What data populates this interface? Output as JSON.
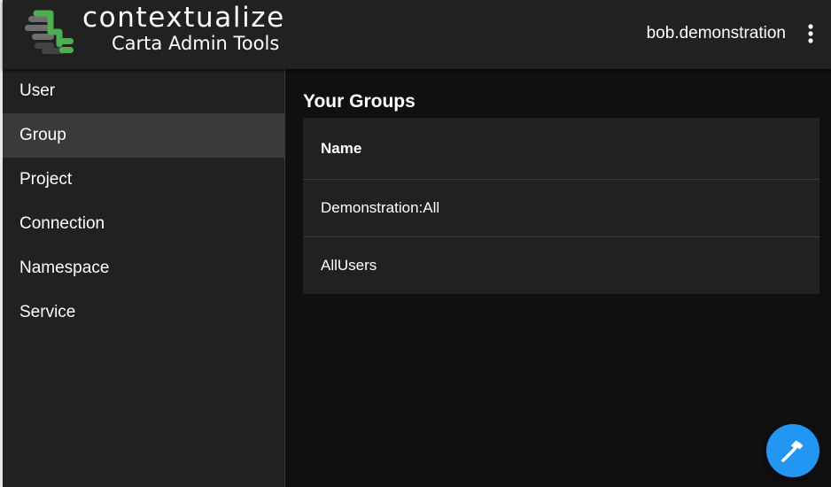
{
  "header": {
    "brand_name": "contextualize",
    "brand_subtitle": "Carta Admin Tools",
    "username": "bob.demonstration",
    "menu_icon": "more-vertical-icon",
    "logo_colors": {
      "green": "#4caf50",
      "gray": "#6f6f6f",
      "dark": "#444444"
    }
  },
  "sidebar": {
    "items": [
      {
        "label": "User",
        "active": false
      },
      {
        "label": "Group",
        "active": true
      },
      {
        "label": "Project",
        "active": false
      },
      {
        "label": "Connection",
        "active": false
      },
      {
        "label": "Namespace",
        "active": false
      },
      {
        "label": "Service",
        "active": false
      }
    ]
  },
  "main": {
    "title": "Your Groups",
    "table": {
      "header": "Name",
      "rows": [
        "Demonstration:All",
        "AllUsers"
      ]
    }
  },
  "fab": {
    "icon": "hammer-icon",
    "color": "#2196f3"
  }
}
